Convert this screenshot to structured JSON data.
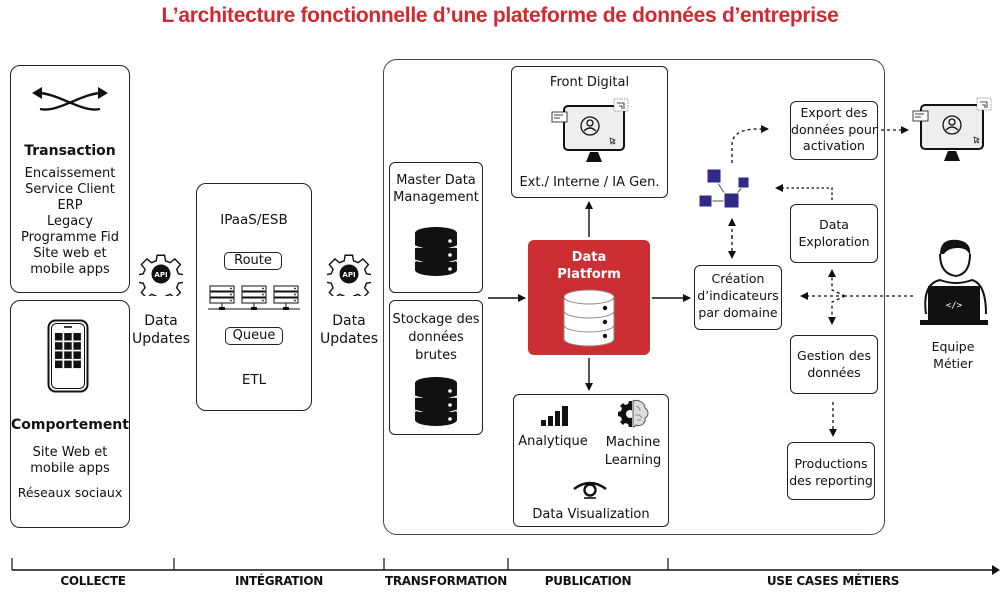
{
  "title": "L’architecture fonctionnelle d’une plateforme de données d’entreprise",
  "colors": {
    "accent": "#d02a30",
    "platform": "#cc2f33",
    "network": "#2e2a86"
  },
  "collecte": {
    "transaction": {
      "icon": "exchange-arrows-icon",
      "heading": "Transaction",
      "items": [
        "Encaissement",
        "Service Client",
        "ERP",
        "Legacy",
        "Programme Fid",
        "Site web et",
        "mobile apps"
      ]
    },
    "comportement": {
      "icon": "smartphone-icon",
      "heading": "Comportement",
      "items": [
        "Site Web et",
        "mobile apps"
      ],
      "extra": "Réseaux sociaux"
    }
  },
  "api_left": {
    "icon_label": "API",
    "label_1": "Data",
    "label_2": "Updates"
  },
  "integration": {
    "title": "IPaaS/ESB",
    "route": "Route",
    "queue": "Queue",
    "footer": "ETL"
  },
  "api_right": {
    "icon_label": "API",
    "label_1": "Data",
    "label_2": "Updates"
  },
  "transformation": {
    "mdm": {
      "line_1": "Master Data",
      "line_2": "Management"
    },
    "raw": {
      "line_1": "Stockage des",
      "line_2": "données",
      "line_3": "brutes"
    }
  },
  "publication": {
    "front": {
      "title": "Front Digital",
      "caption": "Ext./ Interne / IA Gen."
    },
    "platform": {
      "line_1": "Data",
      "line_2": "Platform"
    },
    "outputs": {
      "analytics": "Analytique",
      "ml_1": "Machine",
      "ml_2": "Learning",
      "dataviz": "Data Visualization"
    }
  },
  "use_cases": {
    "indicators": {
      "line_1": "Création",
      "line_2": "d’indicateurs",
      "line_3": "par domaine"
    },
    "export": {
      "line_1": "Export des",
      "line_2": "données pour",
      "line_3": "activation"
    },
    "exploration": {
      "line_1": "Data",
      "line_2": "Exploration"
    },
    "gestion": {
      "line_1": "Gestion des",
      "line_2": "données"
    },
    "reporting": {
      "line_1": "Productions",
      "line_2": "des reporting"
    },
    "team": {
      "line_1": "Equipe",
      "line_2": "Métier",
      "laptop_code": "</>"
    }
  },
  "timeline": {
    "phases": [
      "COLLECTE",
      "INTÉGRATION",
      "TRANSFORMATION",
      "PUBLICATION",
      "USE CASES MÉTIERS"
    ]
  }
}
